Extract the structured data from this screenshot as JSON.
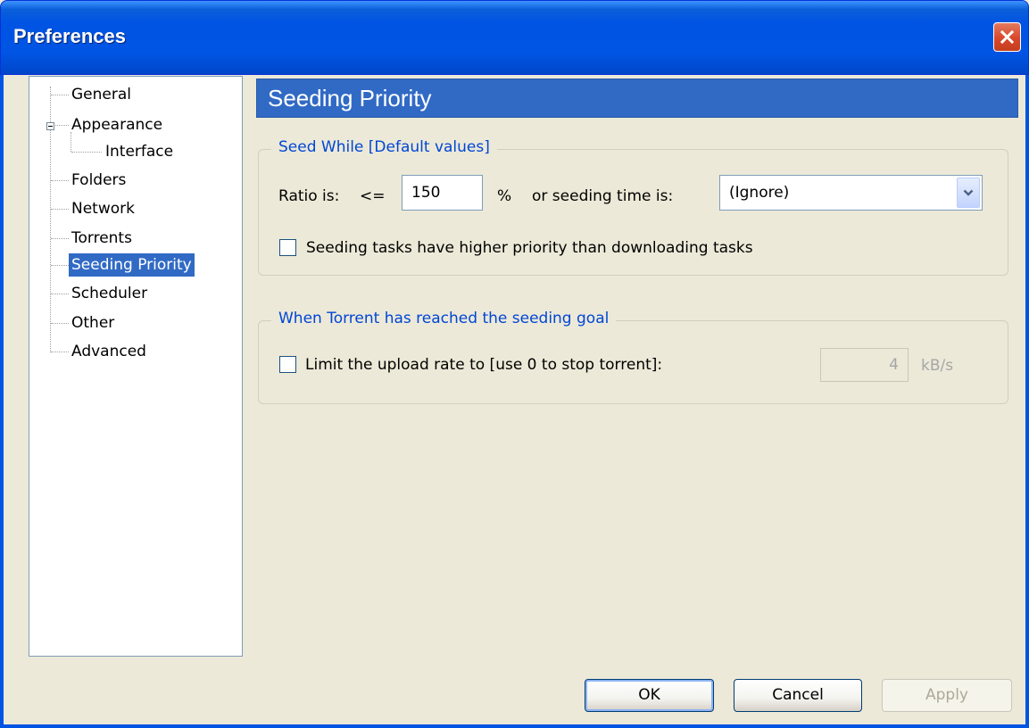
{
  "window": {
    "title": "Preferences"
  },
  "tree": {
    "items": [
      {
        "label": "General"
      },
      {
        "label": "Appearance"
      },
      {
        "label": "Interface"
      },
      {
        "label": "Folders"
      },
      {
        "label": "Network"
      },
      {
        "label": "Torrents"
      },
      {
        "label": "Seeding Priority",
        "selected": true
      },
      {
        "label": "Scheduler"
      },
      {
        "label": "Other"
      },
      {
        "label": "Advanced"
      }
    ]
  },
  "page": {
    "title": "Seeding Priority"
  },
  "seed_while": {
    "legend": "Seed While [Default values]",
    "ratio_label": "Ratio is:",
    "ratio_op": "<=",
    "ratio_value": "150",
    "percent_label": "%",
    "or_time_label": "or seeding time is:",
    "time_select": "(Ignore)",
    "priority_checkbox_label": "Seeding tasks have higher priority than downloading tasks",
    "priority_checked": false
  },
  "goal": {
    "legend": "When Torrent has reached the seeding goal",
    "limit_checkbox_label": "Limit the upload rate to [use 0 to stop torrent]:",
    "limit_checked": false,
    "limit_value": "4",
    "limit_unit": "kB/s"
  },
  "buttons": {
    "ok": "OK",
    "cancel": "Cancel",
    "apply": "Apply"
  },
  "colors": {
    "title_bar": "#0054e3",
    "selection": "#316ac5",
    "legend_text": "#0046d5",
    "close_button": "#d9472a"
  },
  "icons": {
    "close": "close-icon",
    "dropdown": "chevron-down-icon",
    "expander": "tree-collapse-icon"
  }
}
